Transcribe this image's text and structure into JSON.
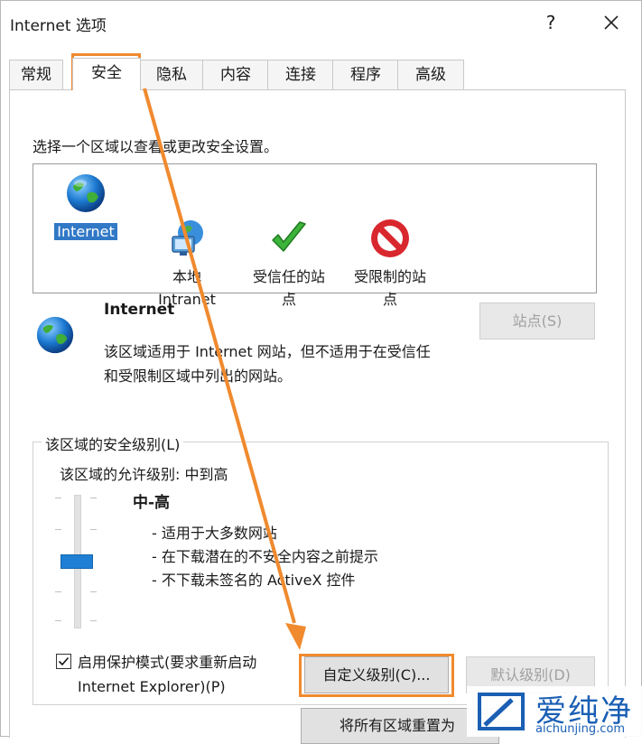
{
  "window": {
    "title": "Internet 选项",
    "help_label": "?"
  },
  "tabs": [
    {
      "label": "常规"
    },
    {
      "label": "安全"
    },
    {
      "label": "隐私"
    },
    {
      "label": "内容"
    },
    {
      "label": "连接"
    },
    {
      "label": "程序"
    },
    {
      "label": "高级"
    }
  ],
  "active_tab": "安全",
  "security": {
    "select_zone_text": "选择一个区域以查看或更改安全设置。",
    "zones": [
      {
        "label": "Internet",
        "icon": "globe-icon",
        "selected": true
      },
      {
        "label": "本地\nIntranet",
        "icon": "intranet-icon",
        "selected": false
      },
      {
        "label": "受信任的站\n点",
        "icon": "checkmark-icon",
        "selected": false
      },
      {
        "label": "受限制的站\n点",
        "icon": "no-entry-icon",
        "selected": false
      }
    ],
    "zone_info": {
      "title": "Internet",
      "description_line1": "该区域适用于 Internet 网站，但不适用于在受信任",
      "description_line2": "和受限制区域中列出的网站。",
      "sites_button": "站点(S)"
    },
    "level_group": {
      "legend": "该区域的安全级别(L)",
      "allowed_levels": "该区域的允许级别: 中到高",
      "level_name": "中-高",
      "level_fraction": 0.5,
      "bullets": [
        "- 适用于大多数网站",
        "- 在下载潜在的不安全内容之前提示",
        "- 不下载未签名的 ActiveX 控件"
      ],
      "protected_mode_label_line1": "启用保护模式(要求重新启动",
      "protected_mode_label_line2": "Internet Explorer)(P)",
      "protected_mode_checked": true,
      "custom_level_button": "自定义级别(C)...",
      "default_level_button": "默认级别(D)"
    },
    "reset_all_button": "将所有区域重置为"
  },
  "colors": {
    "highlight": "#f08a2e",
    "selection": "#3178c6",
    "slider_thumb": "#1e7fd4"
  },
  "watermark": {
    "text": "爱纯净",
    "subtext": "aichunjing.com"
  }
}
